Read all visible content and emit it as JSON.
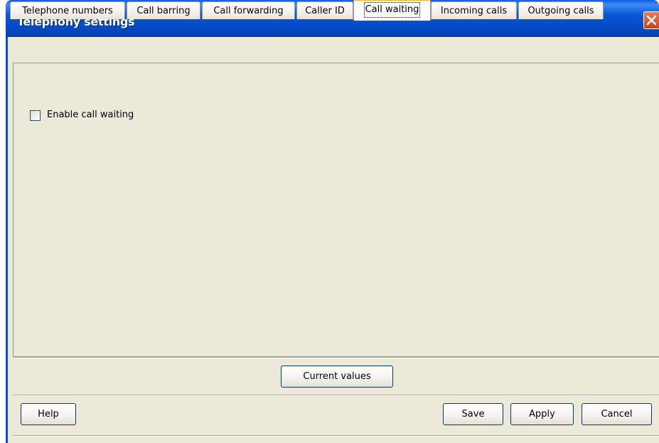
{
  "window": {
    "title": "Telephony settings"
  },
  "tabs": [
    {
      "label": "Telephone numbers",
      "active": false
    },
    {
      "label": "Call barring",
      "active": false
    },
    {
      "label": "Call forwarding",
      "active": false
    },
    {
      "label": "Caller ID",
      "active": false
    },
    {
      "label": "Call waiting",
      "active": true
    },
    {
      "label": "Incoming calls",
      "active": false
    },
    {
      "label": "Outgoing calls",
      "active": false
    }
  ],
  "panel": {
    "enable_call_waiting": {
      "label": "Enable call waiting",
      "checked": false
    }
  },
  "buttons": {
    "current_values": "Current values",
    "help": "Help",
    "save": "Save",
    "apply": "Apply",
    "cancel": "Cancel"
  },
  "icons": {
    "close": "close-icon"
  },
  "colors": {
    "titlebar": "#0a57d6",
    "frame": "#ece9d8",
    "active_tab_highlight": "#f5b342",
    "close_button": "#c9401d"
  }
}
